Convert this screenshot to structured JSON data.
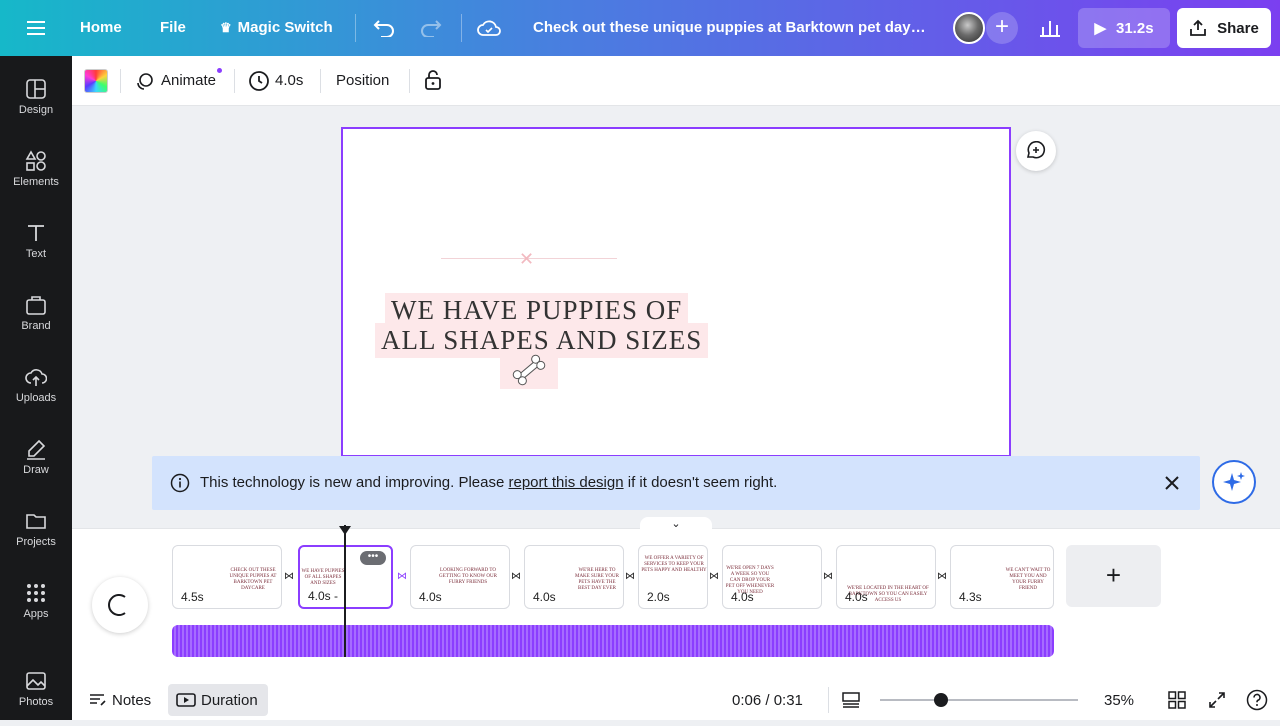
{
  "topbar": {
    "menu_icon": "menu-icon",
    "home_label": "Home",
    "file_label": "File",
    "magic_switch_label": "Magic Switch",
    "design_title": "Check out these unique puppies at Barktown pet daycar...",
    "play_label": "31.2s",
    "share_label": "Share"
  },
  "toolbar": {
    "animate_label": "Animate",
    "duration_label": "4.0s",
    "position_label": "Position"
  },
  "sidebar": {
    "items": [
      {
        "label": "Design",
        "icon": "design-icon"
      },
      {
        "label": "Elements",
        "icon": "elements-icon"
      },
      {
        "label": "Text",
        "icon": "text-icon"
      },
      {
        "label": "Brand",
        "icon": "brand-icon"
      },
      {
        "label": "Uploads",
        "icon": "uploads-icon"
      },
      {
        "label": "Draw",
        "icon": "draw-icon"
      },
      {
        "label": "Projects",
        "icon": "projects-icon"
      },
      {
        "label": "Apps",
        "icon": "apps-icon"
      },
      {
        "label": "Photos",
        "icon": "photos-icon"
      }
    ]
  },
  "canvas": {
    "headline_line1": "WE HAVE PUPPIES OF",
    "headline_line2": "ALL SHAPES AND SIZES"
  },
  "banner": {
    "text_before": "This technology is new and improving. Please ",
    "link_text": "report this design",
    "text_after": " if it doesn't seem right."
  },
  "timeline": {
    "clips": [
      {
        "duration": "4.5s",
        "mini": "CHECK OUT THESE UNIQUE PUPPIES AT BARKTOWN PET DAYCARE"
      },
      {
        "duration": "4.0s -",
        "mini": "WE HAVE PUPPIES OF ALL SHAPES AND SIZES"
      },
      {
        "duration": "4.0s",
        "mini": "LOOKING FORWARD TO GETTING TO KNOW OUR FURRY FRIENDS"
      },
      {
        "duration": "4.0s",
        "mini": "WE'RE HERE TO MAKE SURE YOUR PETS HAVE THE BEST DAY EVER"
      },
      {
        "duration": "2.0s",
        "mini": "WE OFFER A VARIETY OF SERVICES TO KEEP YOUR PETS HAPPY AND HEALTHY"
      },
      {
        "duration": "4.0s",
        "mini": "WE'RE OPEN 7 DAYS A WEEK SO YOU CAN DROP YOUR PET OFF WHENEVER YOU NEED"
      },
      {
        "duration": "4.0s",
        "mini": "WE'RE LOCATED IN THE HEART OF BARKTOWN SO YOU CAN EASILY ACCESS US"
      },
      {
        "duration": "4.3s",
        "mini": "WE CAN'T WAIT TO MEET YOU AND YOUR FURRY FRIEND"
      }
    ]
  },
  "bottom": {
    "notes_label": "Notes",
    "duration_label": "Duration",
    "time_readout": "0:06 / 0:31",
    "zoom_label": "35%",
    "zoom_fraction": 0.31
  },
  "colors": {
    "accent": "#8b3dff",
    "banner_bg": "#d3e3fd",
    "sidebar_bg": "#18191b",
    "highlight_pink": "#fde8ea"
  }
}
